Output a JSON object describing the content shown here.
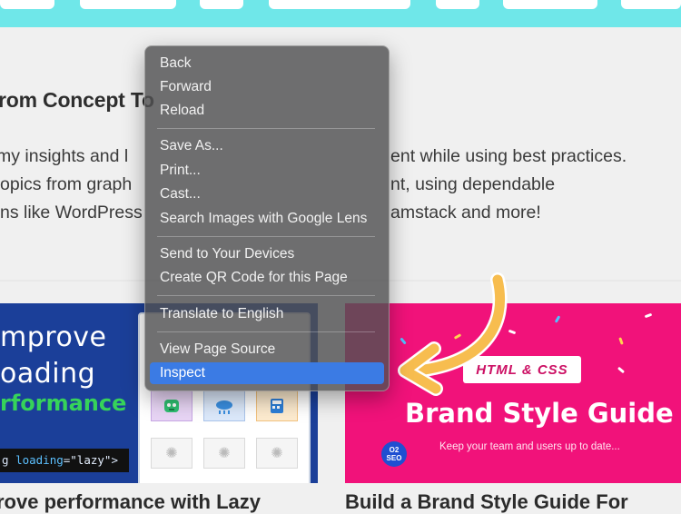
{
  "page": {
    "hero_title": "rom Concept To",
    "intro_lines": [
      {
        "left": " my insights and l",
        "right": "ent while using best practices."
      },
      {
        "left": "opics from graph",
        "right": "nt, using dependable"
      },
      {
        "left": "ns like WordPress",
        "right": "amstack and more!"
      }
    ]
  },
  "cards": [
    {
      "image": {
        "line1": "mprove",
        "line2": "oading",
        "line3": "rformance",
        "code_tag": "g",
        "code_attr": "loading",
        "code_eq": "=",
        "code_val": "\"lazy\"",
        "code_end": ">"
      },
      "title": "rove performance with Lazy"
    },
    {
      "image": {
        "chip": "HTML & CSS",
        "title": "Brand Style Guide",
        "subtitle": "Keep your team and users up to date...",
        "logo_line1": "O2",
        "logo_line2": "SEO"
      },
      "title": "Build a Brand Style Guide For"
    }
  ],
  "context_menu": {
    "groups": [
      [
        {
          "label": "Back"
        },
        {
          "label": "Forward"
        },
        {
          "label": "Reload"
        }
      ],
      [
        {
          "label": "Save As..."
        },
        {
          "label": "Print..."
        },
        {
          "label": "Cast..."
        },
        {
          "label": "Search Images with Google Lens"
        }
      ],
      [
        {
          "label": "Send to Your Devices"
        },
        {
          "label": "Create QR Code for this Page"
        }
      ],
      [
        {
          "label": "Translate to English"
        }
      ],
      [
        {
          "label": "View Page Source"
        },
        {
          "label": "Inspect",
          "highlighted": true
        }
      ]
    ]
  },
  "colors": {
    "nav": "#6fe7e9",
    "menu_highlight": "#3b7be4",
    "left_card": "#1b3f99",
    "right_card": "#f1127a",
    "arrow": "#f7bd4f"
  }
}
